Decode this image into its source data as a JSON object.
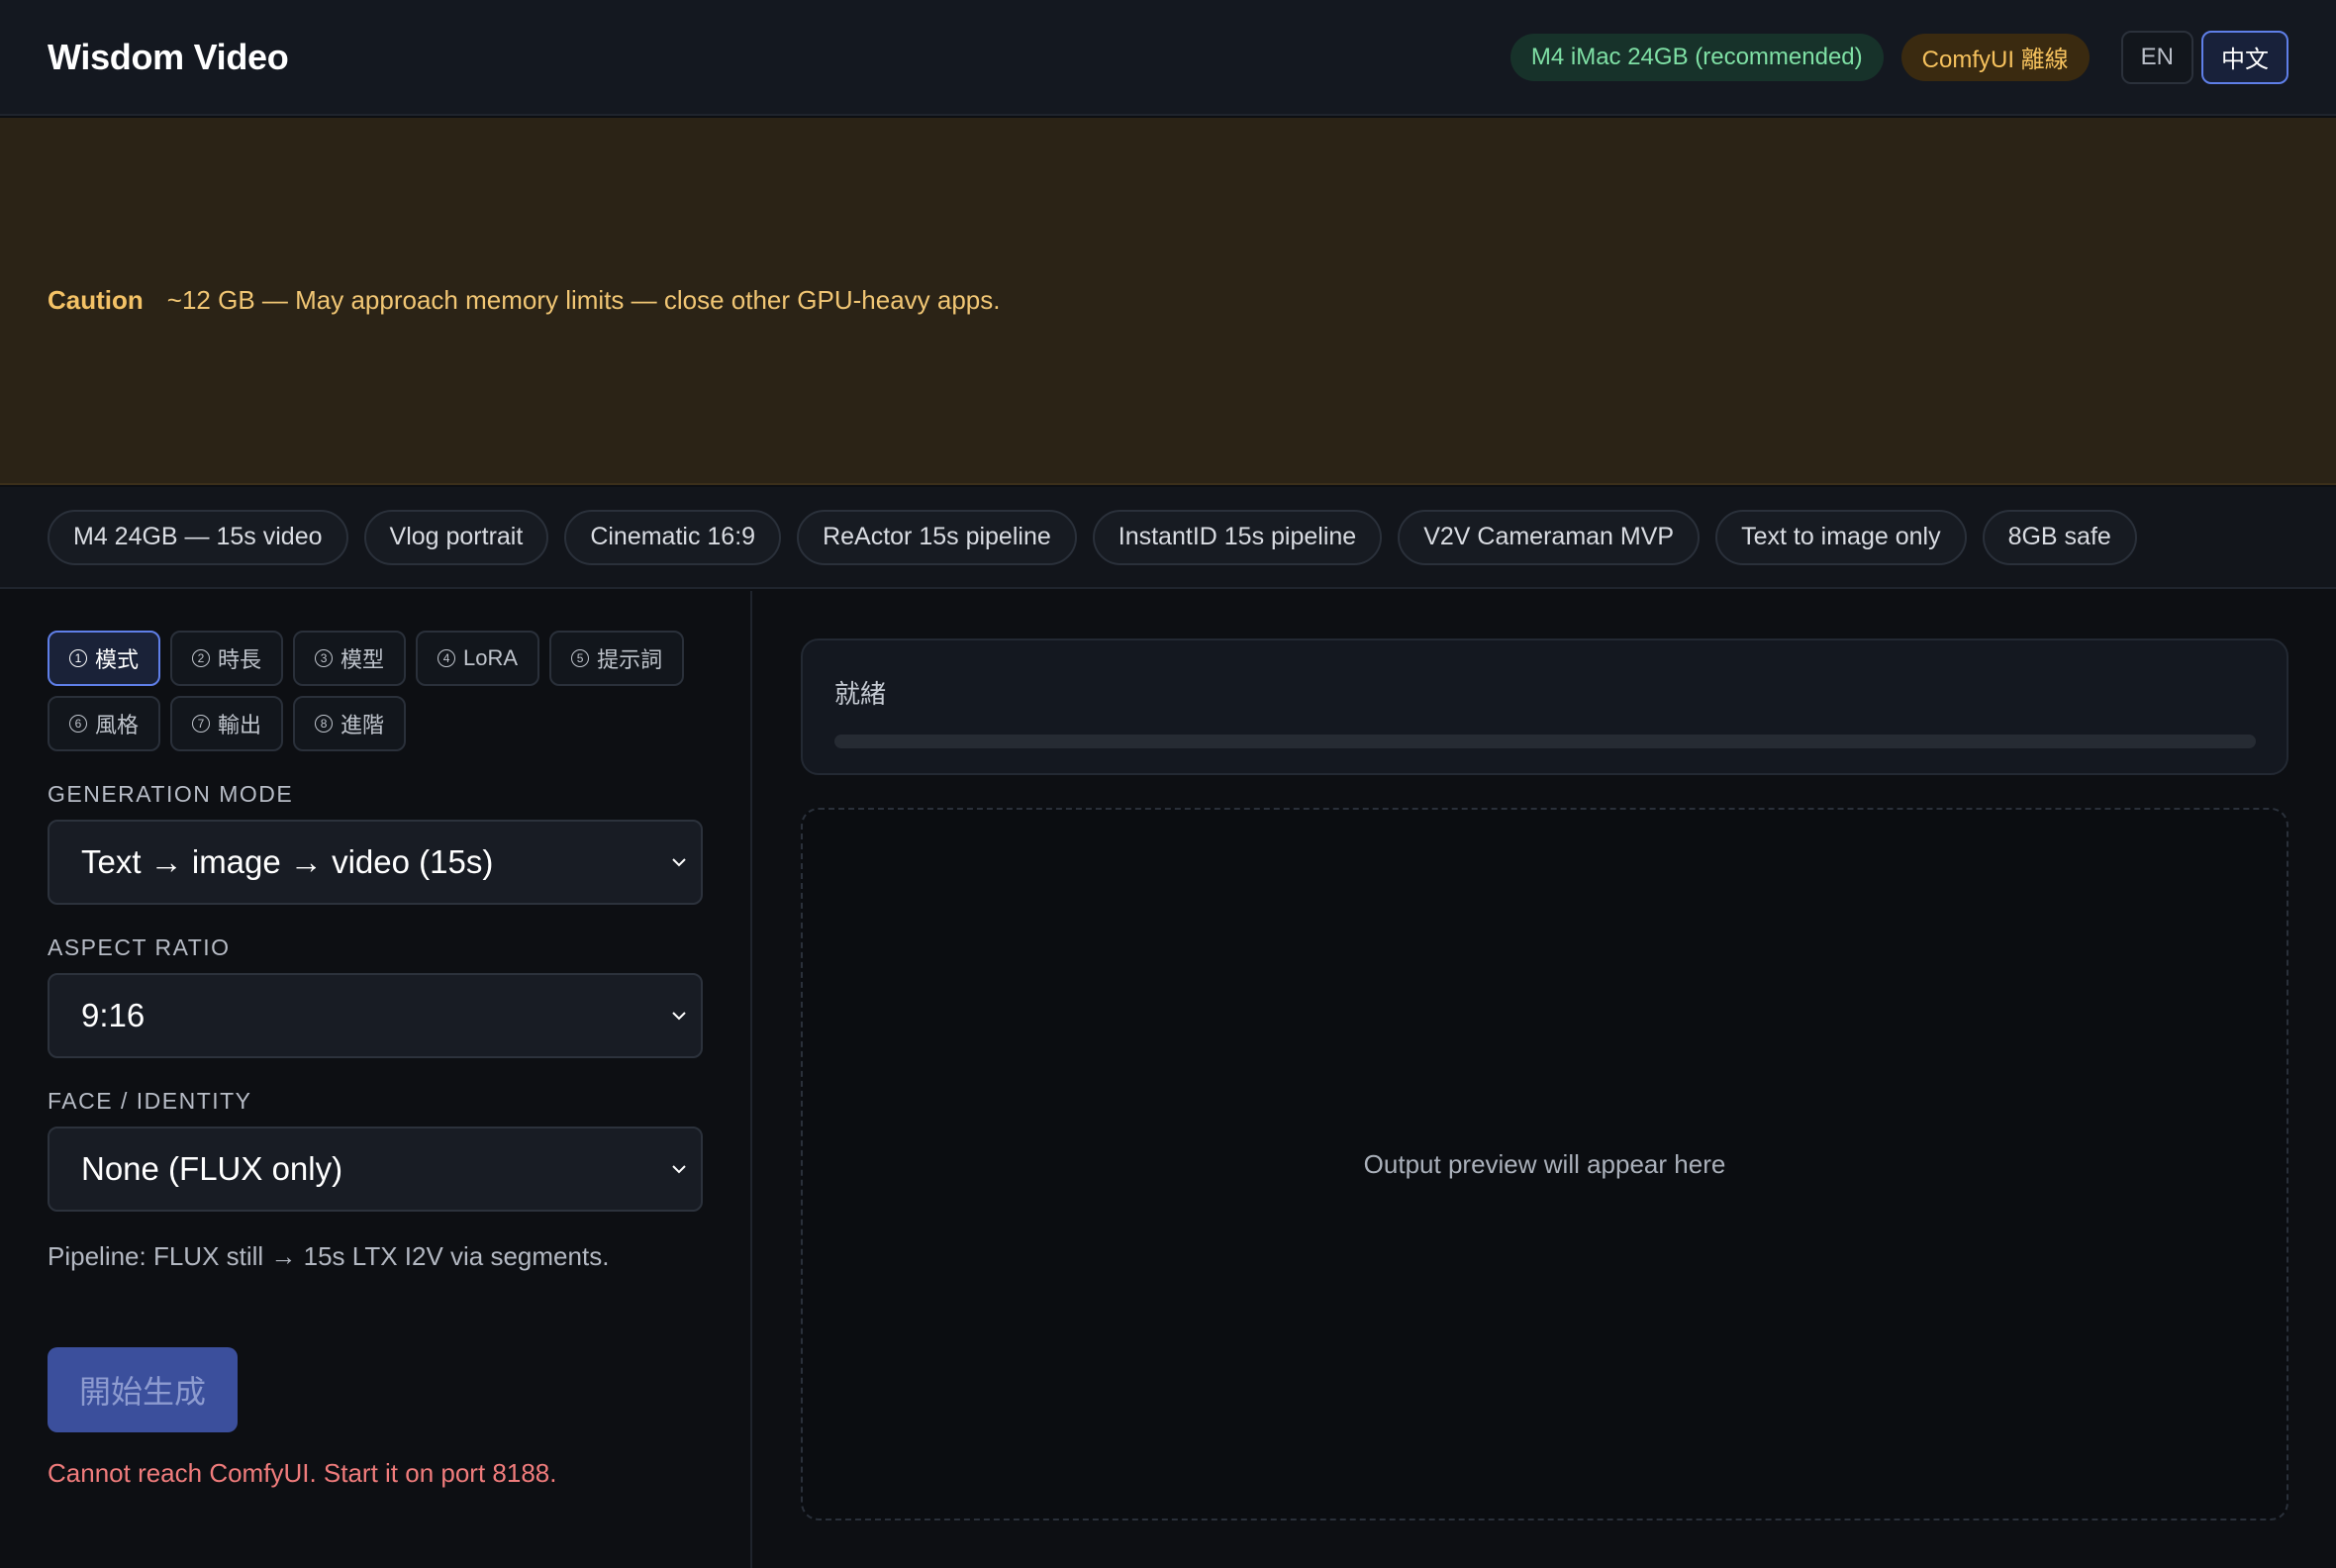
{
  "header": {
    "title": "Wisdom Video",
    "device_badge": "M4 iMac 24GB (recommended)",
    "comfy_badge": "ComfyUI 離線",
    "lang_en": "EN",
    "lang_zh": "中文"
  },
  "caution": {
    "label": "Caution",
    "text": "~12 GB — May approach memory limits — close other GPU-heavy apps."
  },
  "presets": [
    "M4 24GB — 15s video",
    "Vlog portrait",
    "Cinematic 16:9",
    "ReActor 15s pipeline",
    "InstantID 15s pipeline",
    "V2V Cameraman MVP",
    "Text to image only",
    "8GB safe"
  ],
  "steps": [
    {
      "num": "1",
      "label": "模式"
    },
    {
      "num": "2",
      "label": "時長"
    },
    {
      "num": "3",
      "label": "模型"
    },
    {
      "num": "4",
      "label": "LoRA"
    },
    {
      "num": "5",
      "label": "提示詞"
    },
    {
      "num": "6",
      "label": "風格"
    },
    {
      "num": "7",
      "label": "輸出"
    },
    {
      "num": "8",
      "label": "進階"
    }
  ],
  "form": {
    "generation_mode_label": "GENERATION MODE",
    "generation_mode_value": "Text → image → video (15s)",
    "aspect_ratio_label": "ASPECT RATIO",
    "aspect_ratio_value": "9:16",
    "face_label": "FACE / IDENTITY",
    "face_value": "None (FLUX only)",
    "pipeline_note": "Pipeline: FLUX still → 15s LTX I2V via segments.",
    "generate_button": "開始生成",
    "error": "Cannot reach ComfyUI. Start it on port 8188."
  },
  "status": {
    "text": "就緒",
    "progress": 0
  },
  "preview": {
    "placeholder": "Output preview will appear here"
  },
  "colors": {
    "accent": "#5f7fe8",
    "caution": "#f4c266",
    "error": "#f07c7c",
    "success": "#7fe0a5"
  }
}
